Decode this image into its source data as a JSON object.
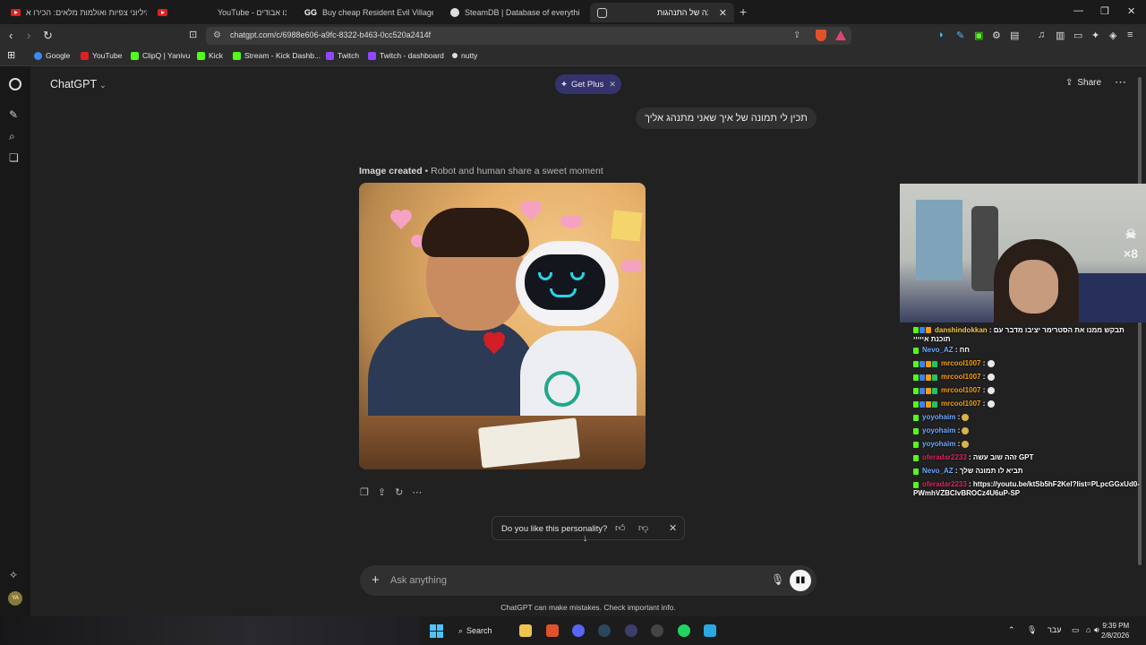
{
  "browser": {
    "tabs": [
      {
        "title": "מיליוני צפיות ואולמות מלאים: הכירו א",
        "icon": "youtube-icon",
        "active": false
      },
      {
        "title": "YouTube - אנחנו אבודים",
        "icon": "youtube-icon",
        "active": false
      },
      {
        "title": "Buy cheap Resident Evil Village Steam",
        "icon": "gg-icon",
        "active": false
      },
      {
        "title": "SteamDB | Database of everything on",
        "icon": "steam-icon",
        "active": false
      },
      {
        "title": "תמונה של התנהגות",
        "icon": "chatgpt-icon",
        "active": true
      }
    ],
    "url": "chatgpt.com/c/6988e606-a9fc-8322-b463-0cc520a2414f",
    "bookmarks": [
      {
        "label": "Google",
        "color": "#4285f4"
      },
      {
        "label": "YouTube",
        "color": "#e02020"
      },
      {
        "label": "ClipQ | Yanivu",
        "color": "#53fc18"
      },
      {
        "label": "Kick",
        "color": "#53fc18"
      },
      {
        "label": "Stream - Kick Dashb...",
        "color": "#53fc18"
      },
      {
        "label": "Twitch",
        "color": "#9146ff"
      },
      {
        "label": "Twitch - dashboard",
        "color": "#9146ff"
      },
      {
        "label": "nutty",
        "color": "#dddddd"
      }
    ]
  },
  "chatgpt": {
    "model": "ChatGPT",
    "get_plus": "Get Plus",
    "share": "Share",
    "user_message": "תכין לי תמונה של איך שאני מתנהג אליך",
    "image_caption_bold": "Image created",
    "image_caption_rest": " • Robot and human share a sweet moment",
    "feedback_question": "Do you like this personality?",
    "composer_placeholder": "Ask anything",
    "disclaimer": "ChatGPT can make mistakes. Check important info.",
    "avatar_initials": "YA"
  },
  "stream": {
    "chat": [
      {
        "user": "danshindokkan",
        "user_color": "#f6c945",
        "badges": [
          "k",
          "b",
          "o"
        ],
        "message": "תבקש ממנו את הסטרימר יציבו מדבר עם תוכנת אייייי"
      },
      {
        "user": "Nevo_AZ",
        "user_color": "#6fa8ff",
        "badges": [
          "k"
        ],
        "message": "חח"
      },
      {
        "user": "mrcool1007",
        "user_color": "#f59e0b",
        "badges": [
          "k",
          "b",
          "o",
          "g"
        ],
        "message": "",
        "emoji": true
      },
      {
        "user": "mrcool1007",
        "user_color": "#f59e0b",
        "badges": [
          "k",
          "b",
          "o",
          "g"
        ],
        "message": "",
        "emoji": true
      },
      {
        "user": "mrcool1007",
        "user_color": "#f59e0b",
        "badges": [
          "k",
          "b",
          "o",
          "g"
        ],
        "message": "",
        "emoji": true
      },
      {
        "user": "mrcool1007",
        "user_color": "#f59e0b",
        "badges": [
          "k",
          "b",
          "o",
          "g"
        ],
        "message": "",
        "emoji": true
      },
      {
        "user": "yoyohaim",
        "user_color": "#6fa8ff",
        "badges": [
          "k"
        ],
        "message": "",
        "emoji": true
      },
      {
        "user": "yoyohaim",
        "user_color": "#6fa8ff",
        "badges": [
          "k"
        ],
        "message": "",
        "emoji": true
      },
      {
        "user": "yoyohaim",
        "user_color": "#6fa8ff",
        "badges": [
          "k"
        ],
        "message": "",
        "emoji": true
      },
      {
        "user": "oferadar2233",
        "user_color": "#e0245e",
        "badges": [
          "k"
        ],
        "message": "זהה שוב עשה GPT"
      },
      {
        "user": "Nevo_AZ",
        "user_color": "#6fa8ff",
        "badges": [
          "k"
        ],
        "message": "תביא לו תמונה שלך"
      },
      {
        "user": "oferadar2233",
        "user_color": "#e0245e",
        "badges": [
          "k"
        ],
        "message": "https://youtu.be/ktSb5hF2Kel?list=PLpcGGxUd0-PWmhVZBClvBROCz4U6uP-SP"
      }
    ]
  },
  "taskbar": {
    "search_label": "Search",
    "lang": "עבר",
    "time": "9:39 PM",
    "date": "2/8/2026"
  }
}
